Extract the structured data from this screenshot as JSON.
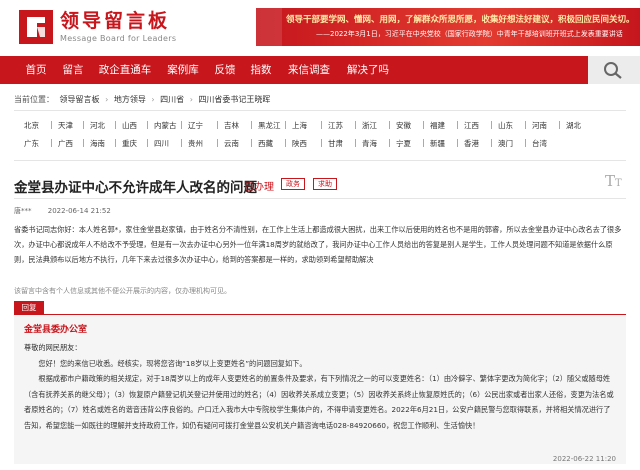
{
  "header": {
    "logo_title": "领导留言板",
    "logo_subtitle": "Message Board for Leaders",
    "banner_line1": "领导干部要学网、懂网、用网，了解群众所思所愿，收集好想法好建议，积极回应民间关切。",
    "banner_line2": "——2022年3月1日，习近平在中央党校（国家行政学院）中青年干部培训班开班式上发表重要讲话",
    "colors": {
      "brand": "#c8161d",
      "banner_text": "#ffeaa7"
    }
  },
  "nav": {
    "items": [
      "首页",
      "留言",
      "政企直通车",
      "案例库",
      "反馈",
      "指数",
      "来信调查",
      "解决了吗"
    ],
    "search_icon": "search-icon"
  },
  "breadcrumb": {
    "prefix": "当前位置：",
    "items": [
      "领导留言板",
      "地方领导",
      "四川省",
      "四川省委书记王晓晖"
    ],
    "separator": "›"
  },
  "regions": {
    "row1": [
      "北京",
      "天津",
      "河北",
      "山西",
      "内蒙古",
      "辽宁",
      "吉林",
      "黑龙江",
      "上海",
      "江苏",
      "浙江",
      "安徽",
      "福建",
      "江西",
      "山东",
      "河南",
      "湖北"
    ],
    "row2": [
      "广东",
      "广西",
      "海南",
      "重庆",
      "四川",
      "贵州",
      "云南",
      "西藏",
      "陕西",
      "甘肃",
      "青海",
      "宁夏",
      "新疆",
      "香港",
      "澳门",
      "台湾"
    ]
  },
  "message": {
    "title": "金堂县办证中心不允许成年人改名的问题",
    "status": "已办理",
    "tags": [
      "政务",
      "求助"
    ],
    "font_icon": "text-size-icon",
    "author": "唐***",
    "time": "2022-06-14 21:52",
    "body": "省委书记同志你好：本人姓名郭*，家住金堂县赵家镇，由于姓名分不清性别，在工作上生活上都造成很大困扰，出来工作以后使用的姓名也不是用的郭睿，所以去金堂县办证中心改名去了很多次，办证中心都说成年人不给改不予受理，但是有一次去办证中心另外一位年满18周岁的就给改了，我问办证中心工作人员给出的答复是别人是学生，工作人员处理问题不知道是依据什么原则，民法典颁布以后地方不执行，几年下来去过很多次办证中心，给到的答案都是一样的，求助领到希望帮助解决",
    "notice": "该留言中含有个人信息或其他不便公开展示的内容，仅办理机构可见。"
  },
  "reply": {
    "label": "回复",
    "org": "金堂县委办公室",
    "greeting": "尊敬的网民朋友：",
    "p1": "您好！您的来信已收悉。经核实，现将您咨询“18岁以上变更姓名”的问题回复如下。",
    "p2": "根据成都市户籍政策的相关规定，对于18周岁以上的成年人变更姓名的前置条件及要求，有下列情况之一的可以变更姓名：（1）由冷僻字、繁体字更改为简化字；（2）随父或随母姓（含有抚养关系的继父母）；（3）恢复原户籍登记机关登记并使用过的姓名；（4）因收养关系成立变更；（5）因收养关系终止恢复原姓氏的；（6）公民出家或者出家人还俗，变更为法名或者原姓名的；（7）姓名或姓名的谐音违背公序良俗的。户口迁入我市大中专院校学生集体户的，不得申请变更姓名。2022年6月21日，公安户籍民警与您取得联系，并将相关情况进行了告知，希望您能一如既往的理解并支持政府工作，如仍有疑问可拨打金堂县公安机关户籍咨询电话028-84920660，祝您工作顺利、生活愉快！",
    "date": "2022-06-22 11:20"
  }
}
